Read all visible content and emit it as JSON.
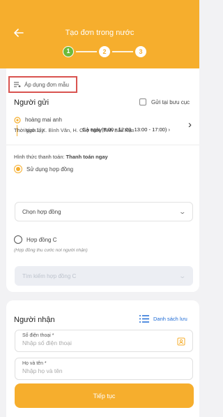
{
  "header": {
    "title": "Tạo đơn trong nước",
    "steps": [
      "1",
      "2",
      "3"
    ],
    "colors": {
      "brand": "#f6ae2d",
      "step_active": "#6dbb3a"
    }
  },
  "template_button": {
    "label": "Áp dụng đơn mẫu"
  },
  "sender": {
    "section_title": "Người gửi",
    "post_office_checkbox_label": "Gửi tại bưu cục",
    "name": "hoàng mai anh",
    "address": "Ngõ 1, X. Bình Văn, H. Chợ Mới, Tỉnh Bắc Kạn",
    "pickup_time_label": "Thời gian lấy",
    "pickup_time_value": "Cả ngày(8:00 - 12:00, 13:00 - 17:00)"
  },
  "payment": {
    "label": "Hình thức thanh toán:",
    "value": "Thanh toán ngay",
    "use_contract_label": "Sử dụng hợp đồng",
    "contract_select_placeholder": "Chọn hợp đồng",
    "contract_c_label": "Hợp đồng C",
    "contract_c_note": "(Hợp đồng thu cước nơi người nhận)",
    "contract_c_search_placeholder": "Tìm kiếm hợp đồng C"
  },
  "receiver": {
    "section_title": "Người nhận",
    "list_link": "Danh sách lưu",
    "phone_label": "Số điện thoại *",
    "phone_placeholder": "Nhập số điện thoại",
    "name_label": "Họ và tên *",
    "name_placeholder": "Nhập họ và tên"
  },
  "continue_button": "Tiếp tục"
}
